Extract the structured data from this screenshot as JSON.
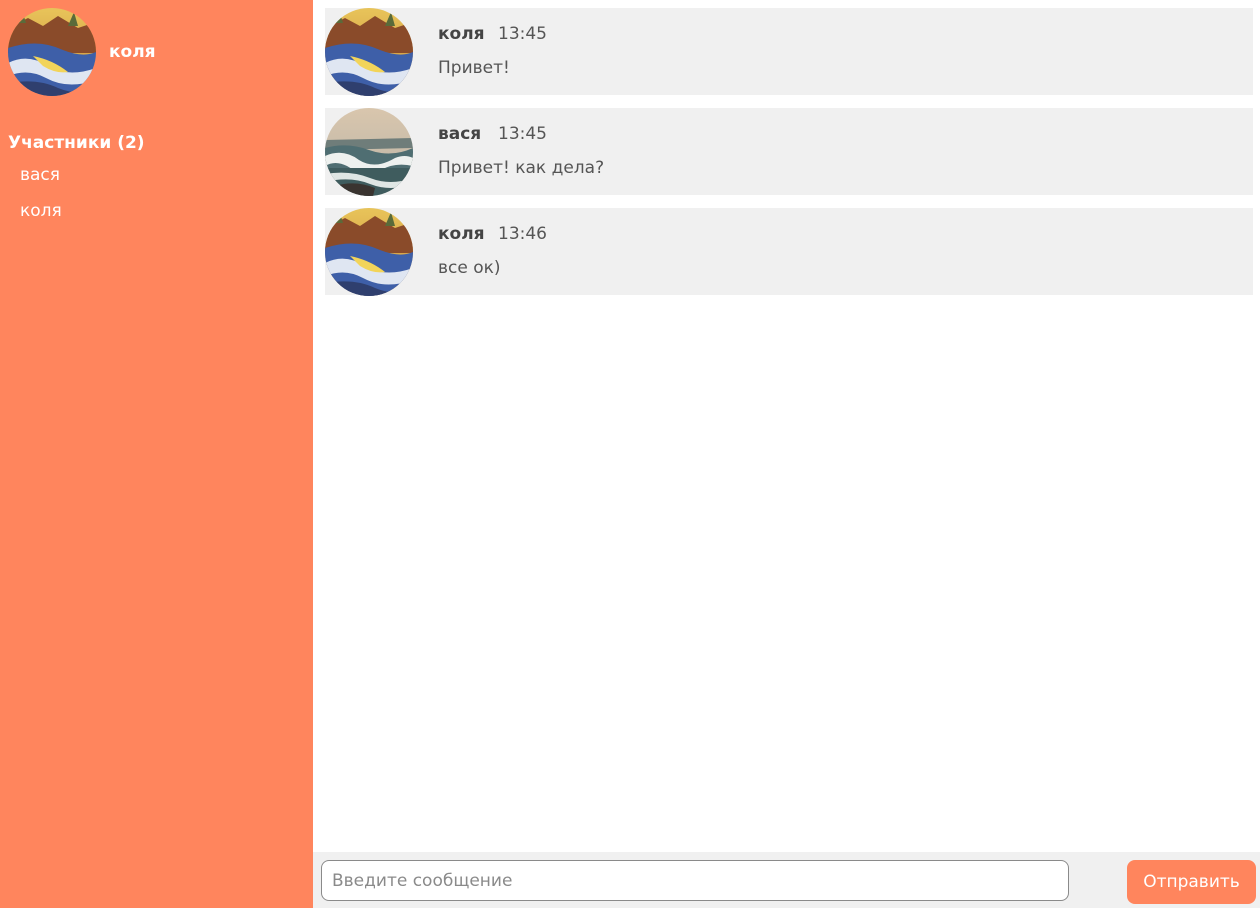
{
  "theme": {
    "accent": "#ff855d",
    "message_bg": "#f0f0f0",
    "page_bg": "#ffffff"
  },
  "current_user": {
    "name": "коля",
    "avatar": "winter-stream-avatar"
  },
  "sidebar": {
    "members_title": "Участники (2)",
    "members": [
      {
        "name": "вася"
      },
      {
        "name": "коля"
      }
    ]
  },
  "messages": [
    {
      "author": "коля",
      "time": "13:45",
      "text": "Привет!",
      "avatar": "winter-stream-avatar"
    },
    {
      "author": "вася",
      "time": "13:45",
      "text": "Привет! как дела?",
      "avatar": "sea-waves-avatar"
    },
    {
      "author": "коля",
      "time": "13:46",
      "text": "все ок)",
      "avatar": "winter-stream-avatar"
    }
  ],
  "composer": {
    "placeholder": "Введите сообщение",
    "send_label": "Отправить"
  }
}
